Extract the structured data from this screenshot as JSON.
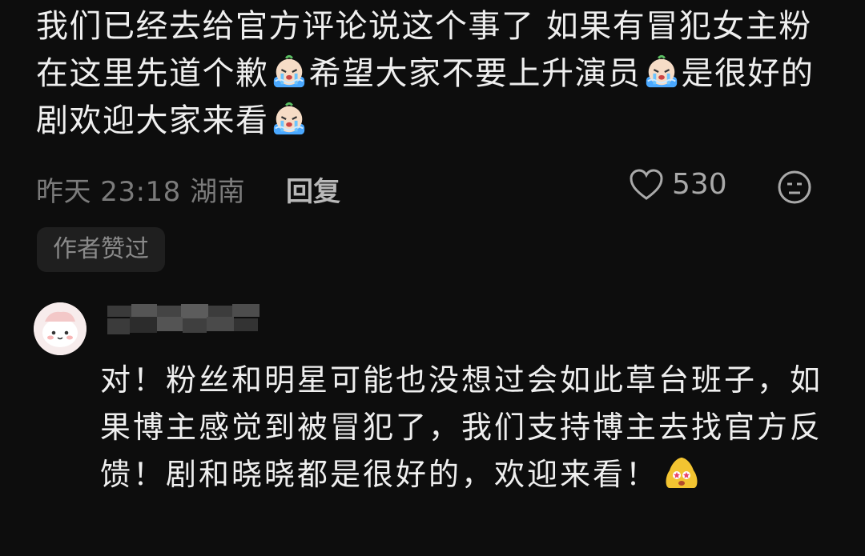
{
  "comment": {
    "text_1": "我们已经去给官方评论说这个事了 如果有冒犯女主粉在这里先道个歉",
    "text_2": "希望大家不要上升演员",
    "text_3": "是很好的剧欢迎大家来看",
    "emoji_icon": "crying-face-emoji",
    "time_location": "昨天 23:18 湖南",
    "reply_label": "回复",
    "like_count": "530",
    "author_liked_badge": "作者赞过"
  },
  "reply": {
    "username_blurred": true,
    "text": "对！粉丝和明星可能也没想过会如此草台班子，如果博主感觉到被冒犯了，我们支持博主去找官方反馈！剧和晓晓都是很好的，欢迎来看！",
    "emoji_icon": "star-eyes-emoji"
  },
  "colors": {
    "background": "#0d0d0d",
    "text": "#efefef",
    "meta": "#7b7b7b",
    "badge_bg": "#1f1f1f"
  }
}
